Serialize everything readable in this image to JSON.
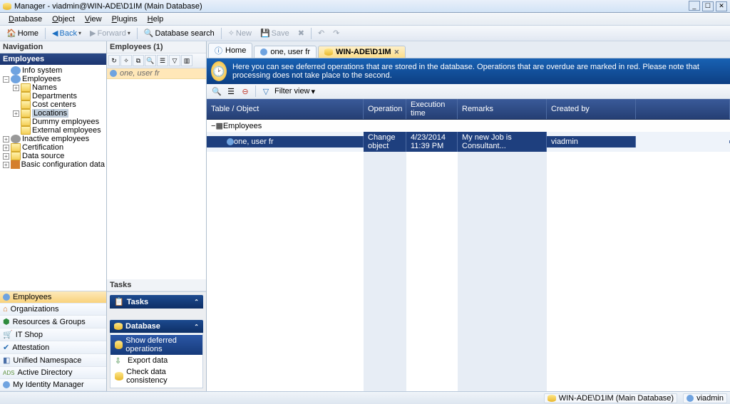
{
  "window": {
    "title": "Manager - viadmin@WIN-ADE\\D1IM (Main Database)"
  },
  "menu": {
    "database": "Database",
    "object": "Object",
    "view": "View",
    "plugins": "Plugins",
    "help": "Help"
  },
  "toolbar": {
    "home": "Home",
    "back": "Back",
    "forward": "Forward",
    "dbsearch": "Database search",
    "new": "New",
    "save": "Save"
  },
  "nav": {
    "title": "Navigation",
    "category": "Employees",
    "tree": {
      "info": "Info system",
      "employees": "Employees",
      "names": "Names",
      "departments": "Departments",
      "costcenters": "Cost centers",
      "locations": "Locations",
      "dummy": "Dummy employees",
      "external": "External employees",
      "inactive": "Inactive employees",
      "certification": "Certification",
      "datasource": "Data source",
      "basic": "Basic configuration data"
    },
    "sections": {
      "employees": "Employees",
      "organizations": "Organizations",
      "resources": "Resources & Groups",
      "itshop": "IT Shop",
      "attestation": "Attestation",
      "unified": "Unified Namespace",
      "ad": "Active Directory",
      "my": "My Identity Manager"
    }
  },
  "mid": {
    "title": "Employees (1)",
    "row": "one, user fr",
    "tasks_title": "Tasks",
    "tasks_header": "Tasks",
    "db_header": "Database",
    "items": {
      "deferred": "Show deferred operations",
      "export": "Export data",
      "check": "Check data consistency"
    }
  },
  "tabs": {
    "home": "Home",
    "user": "one, user fr",
    "win": "WIN-ADE\\D1IM"
  },
  "banner": "Here you can see deferred operations that are stored in the database. Operations that are overdue are marked in red. Please note that processing does not take place to the second.",
  "filter": "Filter view",
  "grid": {
    "h0": "Table / Object",
    "h1": "Operation",
    "h2": "Execution time",
    "h3": "Remarks",
    "h4": "Created by",
    "group": "Employees",
    "r_obj": "one, user fr",
    "r_op": "Change object",
    "r_time": "4/23/2014 11:39 PM",
    "r_remarks": "My new Job is Consultant...",
    "r_by": "viadmin"
  },
  "status": {
    "db": "WIN-ADE\\D1IM (Main Database)",
    "user": "viadmin"
  }
}
